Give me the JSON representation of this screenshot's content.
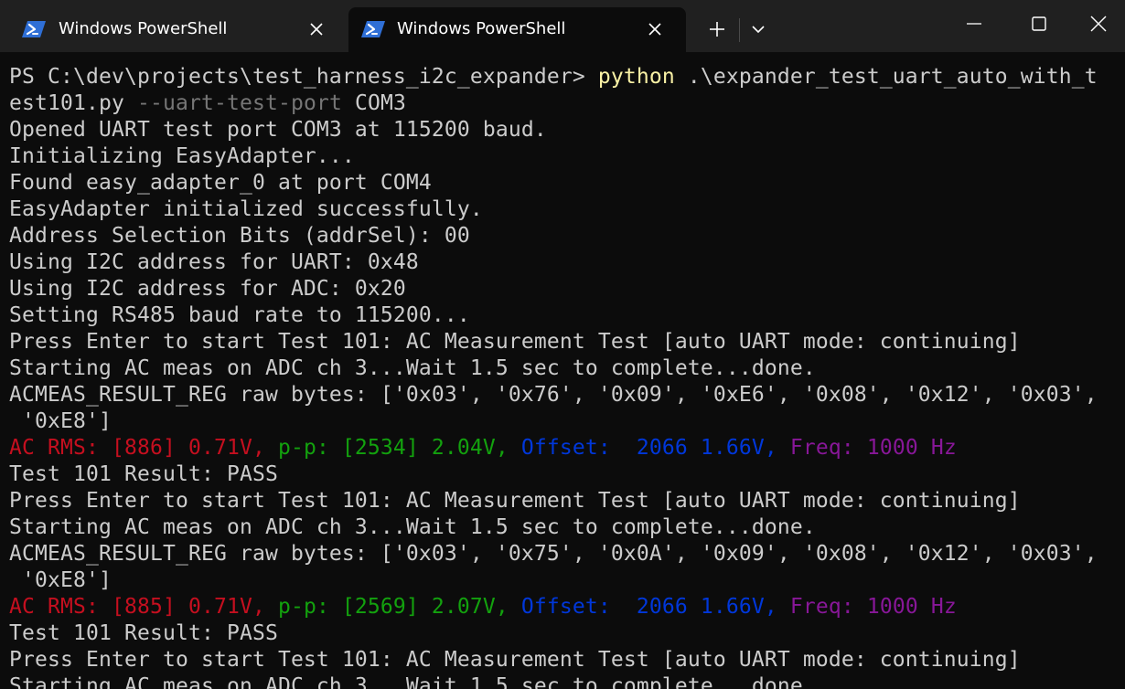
{
  "tabs": [
    {
      "label": "Windows PowerShell",
      "active": false,
      "icon": "powershell-icon"
    },
    {
      "label": "Windows PowerShell",
      "active": true,
      "icon": "powershell-icon"
    }
  ],
  "colors": {
    "background": "#0c0c0c",
    "titlebar": "#202020",
    "text": "#cccccc",
    "command": "#f9f1a5",
    "parameter": "#767676",
    "rms": "#c50f1f",
    "pp": "#13a10e",
    "offset": "#0037da",
    "freq": "#881798",
    "powershell_icon": "#2f6fd6"
  },
  "terminal": {
    "prompt_line": {
      "prompt": "PS C:\\dev\\projects\\test_harness_i2c_expander> ",
      "command": "python",
      "args": " .\\expander_test_uart_auto_with_t"
    },
    "wrap_line": {
      "text": "est101.py ",
      "param": "--uart-test-port",
      "value": " COM3"
    },
    "init_lines": [
      "Opened UART test port COM3 at 115200 baud.",
      "Initializing EasyAdapter...",
      "Found easy_adapter_0 at port COM4",
      "EasyAdapter initialized successfully.",
      "Address Selection Bits (addrSel): 00",
      "Using I2C address for UART: 0x48",
      "Using I2C address for ADC: 0x20",
      "Setting RS485 baud rate to 115200..."
    ],
    "run1": {
      "press": "Press Enter to start Test 101: AC Measurement Test [auto UART mode: continuing]",
      "starting": "Starting AC meas on ADC ch 3...Wait 1.5 sec to complete...done.",
      "raw1": "ACMEAS_RESULT_REG raw bytes: ['0x03', '0x76', '0x09', '0xE6', '0x08', '0x12', '0x03',",
      "raw2": " '0xE8']",
      "rms": "AC RMS: [886] 0.71V,",
      "pp": " p-p: [2534] 2.04V,",
      "offset": " Offset:  2066 1.66V,",
      "freq": " Freq: 1000 Hz",
      "result": "Test 101 Result: PASS"
    },
    "run2": {
      "press": "Press Enter to start Test 101: AC Measurement Test [auto UART mode: continuing]",
      "starting": "Starting AC meas on ADC ch 3...Wait 1.5 sec to complete...done.",
      "raw1": "ACMEAS_RESULT_REG raw bytes: ['0x03', '0x75', '0x0A', '0x09', '0x08', '0x12', '0x03',",
      "raw2": " '0xE8']",
      "rms": "AC RMS: [885] 0.71V,",
      "pp": " p-p: [2569] 2.07V,",
      "offset": " Offset:  2066 1.66V,",
      "freq": " Freq: 1000 Hz",
      "result": "Test 101 Result: PASS"
    },
    "run3": {
      "press": "Press Enter to start Test 101: AC Measurement Test [auto UART mode: continuing]",
      "starting": "Starting AC meas on ADC ch 3...Wait 1.5 sec to complete...done."
    }
  }
}
